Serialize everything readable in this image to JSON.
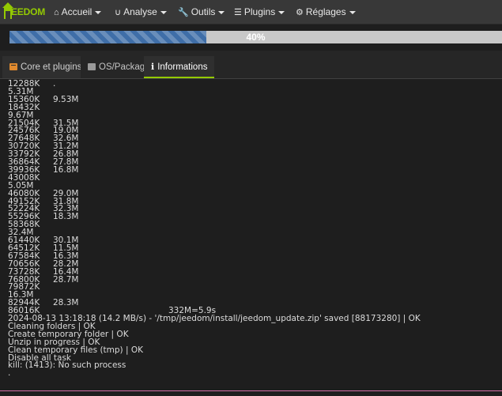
{
  "navbar": {
    "brand": "EEDOM",
    "items": [
      {
        "label": "Accueil",
        "icon": "home-icon"
      },
      {
        "label": "Analyse",
        "icon": "stethoscope-icon"
      },
      {
        "label": "Outils",
        "icon": "wrench-icon"
      },
      {
        "label": "Plugins",
        "icon": "tasks-icon"
      },
      {
        "label": "Réglages",
        "icon": "gear-icon"
      }
    ]
  },
  "progress": {
    "value": 0.4,
    "label": "40%",
    "fill_color": "#3f6ea8"
  },
  "tabs": [
    {
      "label": "Core et plugins",
      "icon": "box-icon",
      "active": false
    },
    {
      "label": "OS/Package",
      "icon": "calendar-icon",
      "active": false
    },
    {
      "label": "Informations",
      "icon": "info-icon",
      "active": true
    }
  ],
  "log": [
    {
      "a": "12288K",
      "b": "."
    },
    {
      "a": "5.31M",
      "b": ""
    },
    {
      "a": "15360K",
      "b": "9.53M"
    },
    {
      "a": "18432K",
      "b": ""
    },
    {
      "a": "9.67M",
      "b": ""
    },
    {
      "a": "21504K",
      "b": "31.5M"
    },
    {
      "a": "24576K",
      "b": "19.0M"
    },
    {
      "a": "27648K",
      "b": "32.6M"
    },
    {
      "a": "30720K",
      "b": "31.2M"
    },
    {
      "a": "33792K",
      "b": "26.8M"
    },
    {
      "a": "36864K",
      "b": "27.8M"
    },
    {
      "a": "39936K",
      "b": "16.8M"
    },
    {
      "a": "43008K",
      "b": ""
    },
    {
      "a": "5.05M",
      "b": ""
    },
    {
      "a": "46080K",
      "b": "29.0M"
    },
    {
      "a": "49152K",
      "b": "31.8M"
    },
    {
      "a": "52224K",
      "b": "32.3M"
    },
    {
      "a": "55296K",
      "b": "18.3M"
    },
    {
      "a": "58368K",
      "b": ""
    },
    {
      "a": "32.4M",
      "b": ""
    },
    {
      "a": "61440K",
      "b": "30.1M"
    },
    {
      "a": "64512K",
      "b": "11.5M"
    },
    {
      "a": "67584K",
      "b": "16.3M"
    },
    {
      "a": "70656K",
      "b": "28.2M"
    },
    {
      "a": "73728K",
      "b": "16.4M"
    },
    {
      "a": "76800K",
      "b": "28.7M"
    },
    {
      "a": "79872K",
      "b": ""
    },
    {
      "a": "16.3M",
      "b": ""
    },
    {
      "a": "82944K",
      "b": "28.3M"
    },
    {
      "a": "86016K",
      "b": "",
      "tail": "332M=5.9s"
    },
    {
      "a": "2024-08-13 13:18:18 (14.2 MB/s) - '/tmp/jeedom/install/jeedom_update.zip' saved [88173280] | OK",
      "b": ""
    },
    {
      "a": "Cleaning folders | OK",
      "b": ""
    },
    {
      "a": "Create temporary folder | OK",
      "b": ""
    },
    {
      "a": "Unzip in progress | OK",
      "b": ""
    },
    {
      "a": "Clean temporary files (tmp) | OK",
      "b": ""
    },
    {
      "a": "Disable all task",
      "b": ""
    },
    {
      "a": "kill: (1413): No such process",
      "b": ""
    },
    {
      "a": ".",
      "b": ""
    }
  ]
}
